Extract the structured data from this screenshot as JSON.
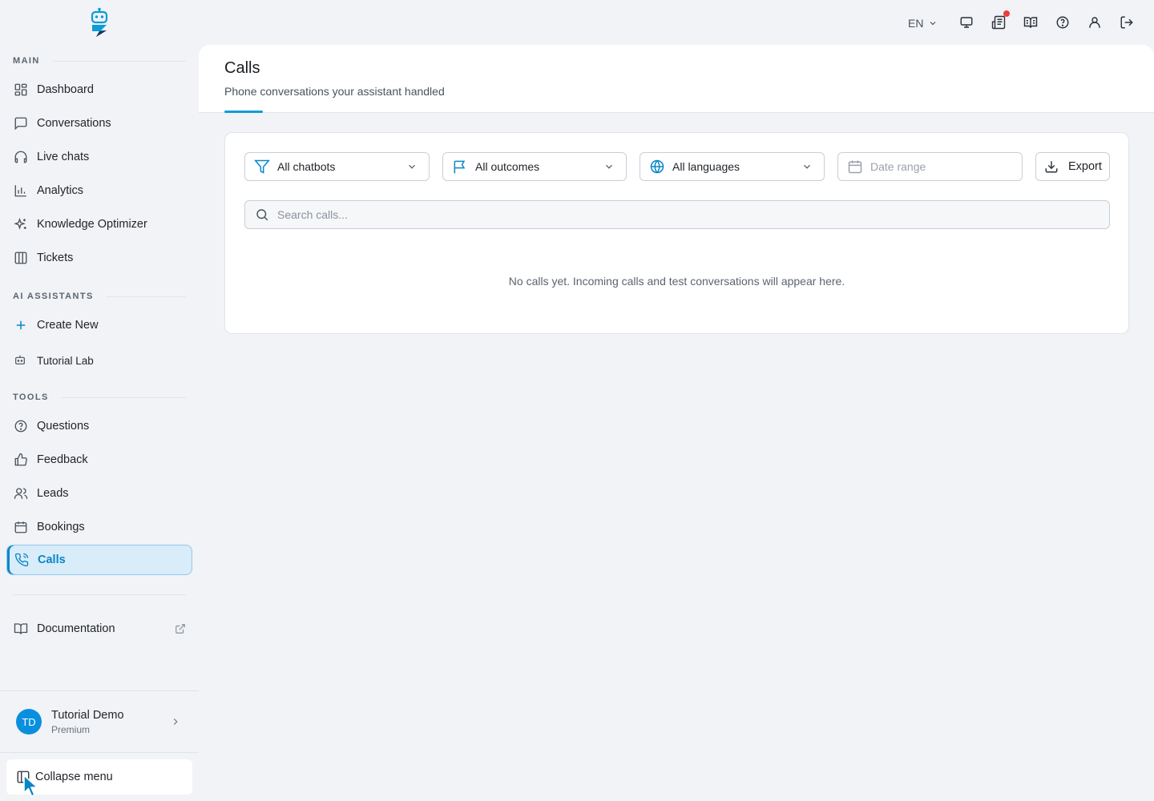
{
  "sidebar": {
    "sections": {
      "main": "MAIN",
      "ai_assistants": "AI ASSISTANTS",
      "tools": "TOOLS"
    },
    "main_items": [
      "Dashboard",
      "Conversations",
      "Live chats",
      "Analytics",
      "Knowledge Optimizer",
      "Tickets"
    ],
    "assistant_items": [
      "Create New",
      "Tutorial Lab"
    ],
    "tool_items": [
      "Questions",
      "Feedback",
      "Leads",
      "Bookings",
      "Calls"
    ],
    "active_item": "Calls",
    "documentation": "Documentation",
    "user": {
      "initials": "TD",
      "name": "Tutorial Demo",
      "plan": "Premium"
    },
    "collapse_label": "Collapse menu"
  },
  "topbar": {
    "language": "EN",
    "icons": [
      "monitor-icon",
      "news-icon",
      "book-open-icon",
      "help-icon",
      "user-icon",
      "logout-icon"
    ],
    "notification_color": "#ef3b3b"
  },
  "page": {
    "title": "Calls",
    "subtitle": "Phone conversations your assistant handled"
  },
  "filters": {
    "chatbots": "All chatbots",
    "outcomes": "All outcomes",
    "languages": "All languages",
    "date_placeholder": "Date range",
    "export_label": "Export"
  },
  "search": {
    "placeholder": "Search calls...",
    "value": ""
  },
  "empty_state": "No calls yet. Incoming calls and test conversations will appear here.",
  "colors": {
    "accent": "#0a86c8",
    "active_bg": "#d9ecf9",
    "avatar": "#0a8fde"
  }
}
